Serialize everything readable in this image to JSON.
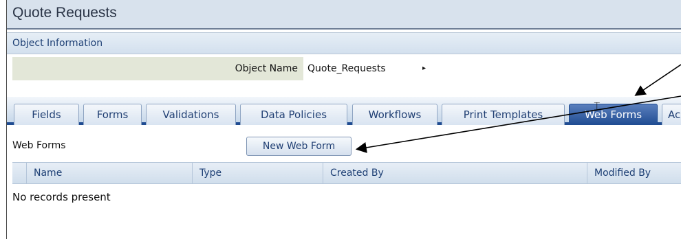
{
  "window": {
    "title": "Quote Requests"
  },
  "section": {
    "header": "Object Information"
  },
  "object_info": {
    "label": "Object Name",
    "value": "Quote_Requests",
    "caret": "▸"
  },
  "tabs": [
    {
      "label": "Fields"
    },
    {
      "label": "Forms"
    },
    {
      "label": "Validations"
    },
    {
      "label": "Data Policies"
    },
    {
      "label": "Workflows"
    },
    {
      "label": "Print Templates"
    },
    {
      "label": "Web Forms",
      "active": true
    },
    {
      "label": "Ac"
    }
  ],
  "web_forms": {
    "label": "Web Forms",
    "new_button": "New Web Form",
    "columns": [
      "Name",
      "Type",
      "Created By",
      "Modified By"
    ],
    "empty_message": "No records present"
  },
  "colors": {
    "accent": "#1f4c92",
    "header_bg": "#d8e2ed",
    "label_bg": "#e3e7d8"
  },
  "icons": {
    "caret": "caret-right-icon",
    "text_cursor": "text-cursor-icon"
  }
}
